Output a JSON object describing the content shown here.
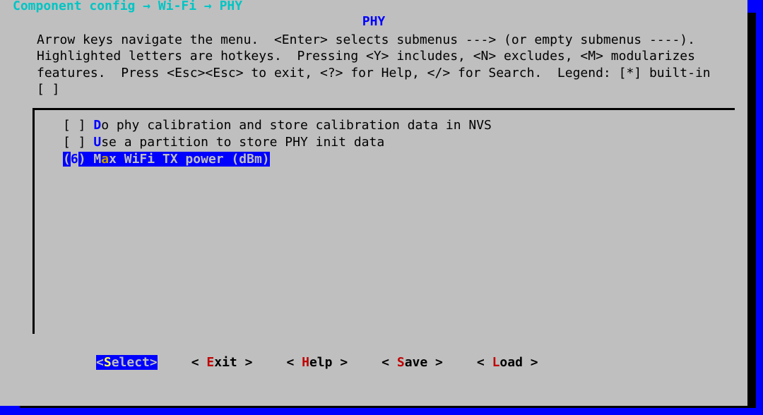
{
  "breadcrumb": "Component config → Wi-Fi → PHY",
  "title": "PHY",
  "help_text": "Arrow keys navigate the menu.  <Enter> selects submenus ---> (or empty submenus ----).  Highlighted letters are hotkeys.  Pressing <Y> includes, <N> excludes, <M> modularizes features.  Press <Esc><Esc> to exit, <?> for Help, </> for Search.  Legend: [*] built-in  [ ]",
  "menu": {
    "items": [
      {
        "prefix": "[ ] ",
        "hotkey": "D",
        "label_rest": "o phy calibration and store calibration data in NVS",
        "selected": false
      },
      {
        "prefix": "[ ] ",
        "hotkey": "U",
        "label_rest": "se a partition to store PHY init data",
        "selected": false
      },
      {
        "prefix_open": "(",
        "value": "6",
        "prefix_close": ") ",
        "pre_hotkey": "M",
        "hotkey": "a",
        "label_rest": "x WiFi TX power (dBm)",
        "selected": true
      }
    ]
  },
  "buttons": {
    "select": {
      "open": "<",
      "hot": "S",
      "rest": "elect>",
      "active": true
    },
    "exit": {
      "open": "< ",
      "hot": "E",
      "rest": "xit >",
      "active": false
    },
    "help": {
      "open": "< ",
      "hot": "H",
      "rest": "elp >",
      "active": false
    },
    "save": {
      "open": "< ",
      "hot": "S",
      "rest": "ave >",
      "active": false
    },
    "load": {
      "open": "< ",
      "hot": "L",
      "rest": "oad >",
      "active": false
    }
  }
}
